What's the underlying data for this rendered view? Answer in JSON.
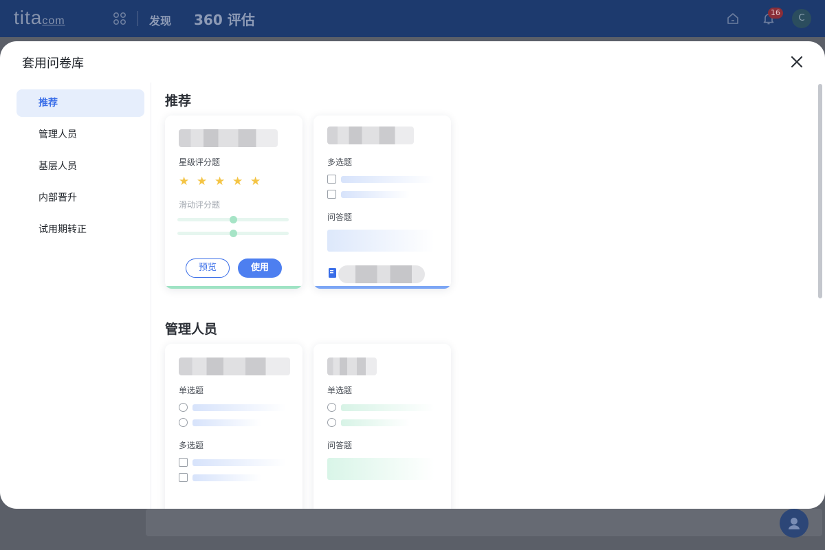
{
  "topbar": {
    "logo": "tita",
    "logo_suffix": "com",
    "nav_discover": "发现",
    "nav_360": "360 评估",
    "notification_count": "16",
    "avatar_initial": "C"
  },
  "modal": {
    "title": "套用问卷库",
    "close_icon": "close-icon"
  },
  "sidebar": {
    "items": [
      {
        "label": "推荐",
        "active": true
      },
      {
        "label": "管理人员",
        "active": false
      },
      {
        "label": "基层人员",
        "active": false
      },
      {
        "label": "内部晋升",
        "active": false
      },
      {
        "label": "试用期转正",
        "active": false
      }
    ]
  },
  "sections": [
    {
      "title": "推荐",
      "cards": [
        {
          "questions": [
            "星级评分题",
            "滑动评分题"
          ],
          "star_rating": 5,
          "slider_levels": [
            0.5,
            0.5
          ],
          "preview_label": "预览",
          "use_label": "使用",
          "accent": "#9fe3c4"
        },
        {
          "questions": [
            "多选题",
            "问答题"
          ],
          "accent": "#7ca6f5",
          "footer_icon": "document-icon"
        }
      ]
    },
    {
      "title": "管理人员",
      "cards": [
        {
          "questions": [
            "单选题",
            "多选题"
          ]
        },
        {
          "questions": [
            "单选题",
            "问答题"
          ]
        }
      ]
    }
  ],
  "colors": {
    "primary": "#3a6ee8",
    "use_button": "#4d7ff0",
    "star": "#f4c444",
    "topbar": "#1d3a6e"
  }
}
